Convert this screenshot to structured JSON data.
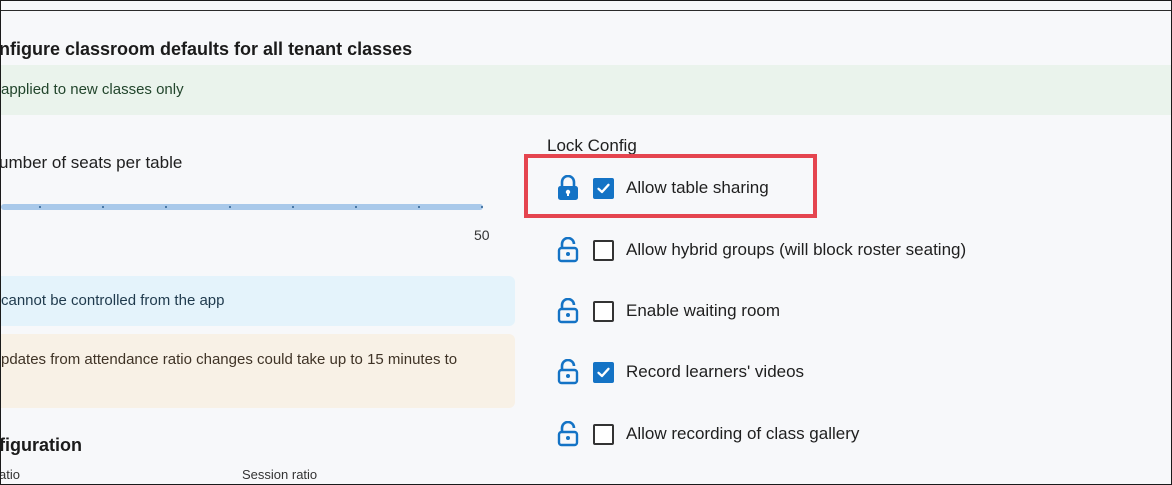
{
  "page": {
    "title": "nfigure classroom defaults for all tenant classes",
    "notice_green": "applied to new classes only",
    "seats": {
      "label": "umber of seats per table",
      "max_label": "50"
    },
    "notice_blue": "cannot be controlled from the app",
    "notice_orange": "pdates from attendance ratio changes could take up to 15 minutes to",
    "config_title": "figuration",
    "columns": [
      "atio",
      "Session ratio"
    ]
  },
  "lock_config": {
    "label": "Lock Config",
    "options": [
      {
        "label": "Allow table sharing",
        "checked": true,
        "locked": true
      },
      {
        "label": "Allow hybrid groups (will block roster seating)",
        "checked": false,
        "locked": false
      },
      {
        "label": "Enable waiting room",
        "checked": false,
        "locked": false
      },
      {
        "label": "Record learners' videos",
        "checked": true,
        "locked": false
      },
      {
        "label": "Allow recording of class gallery",
        "checked": false,
        "locked": false
      }
    ]
  },
  "colors": {
    "accent": "#1473c5",
    "highlight": "#e5454f"
  }
}
